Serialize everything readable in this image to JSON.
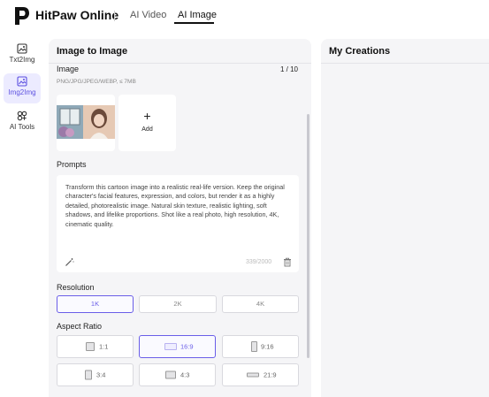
{
  "app": {
    "name": "HitPaw Online"
  },
  "top_tabs": [
    {
      "label": "AI Video"
    },
    {
      "label": "AI Image"
    }
  ],
  "nav": [
    {
      "label": "Txt2Img",
      "icon": "image-text-icon"
    },
    {
      "label": "Img2Img",
      "icon": "image-swap-icon"
    },
    {
      "label": "AI Tools",
      "icon": "tools-grid-icon"
    }
  ],
  "panel": {
    "title": "Image to Image",
    "image_label": "Image",
    "image_count": "1 / 10",
    "formats_hint": "PNG/JPG/JPEG/WEBP, ≤ 7MB",
    "add_label": "Add",
    "add_icon": "plus-icon",
    "prompts_label": "Prompts",
    "prompt_text": "Transform this cartoon image into a realistic real-life version. Keep the original character's facial features, expression, and colors, but render it as a highly detailed, photorealistic image. Natural skin texture, realistic lighting, soft shadows, and lifelike proportions. Shot like a real photo, high resolution, 4K, cinematic quality.",
    "char_count": "339/2000",
    "resolution_label": "Resolution",
    "resolutions": [
      "1K",
      "2K",
      "4K"
    ],
    "selected_resolution": "1K",
    "aspect_label": "Aspect Ratio",
    "aspect_ratios": [
      "1:1",
      "16:9",
      "9:16",
      "3:4",
      "4:3",
      "21:9"
    ],
    "selected_aspect": "16:9"
  },
  "creations": {
    "title": "My Creations"
  },
  "colors": {
    "accent": "#6a5ee8",
    "panel_bg": "#f5f5f7",
    "nav_active_bg": "#ecebff"
  }
}
